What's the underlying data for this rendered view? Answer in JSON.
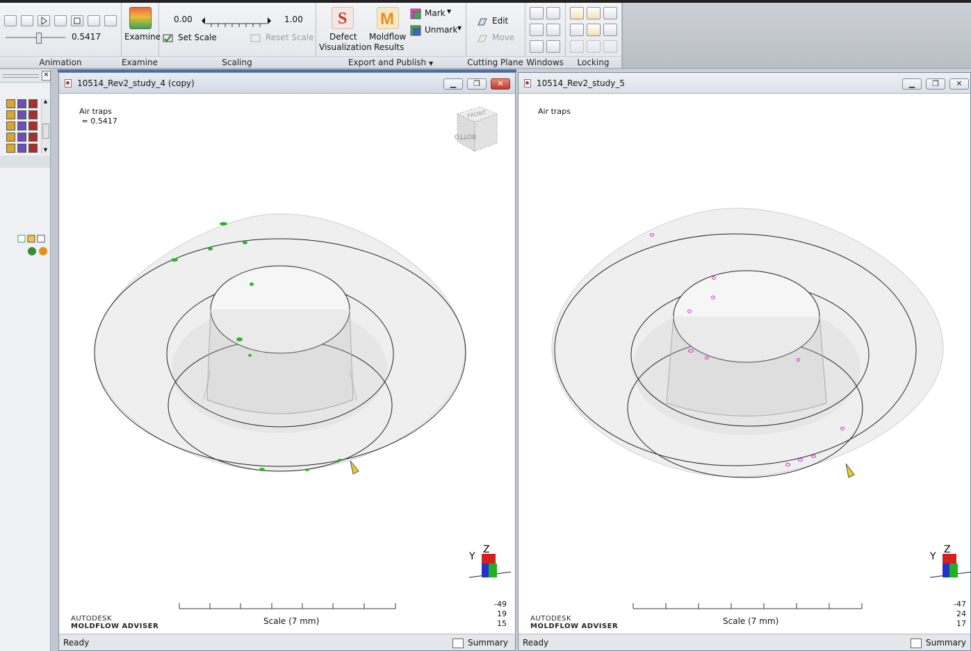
{
  "ribbon": {
    "animation": {
      "label": "Animation",
      "value": "0.5417",
      "progress": 0.5417
    },
    "examine": {
      "label": "Examine",
      "button": "Examine"
    },
    "scaling": {
      "label": "Scaling",
      "min": "0.00",
      "max": "1.00",
      "set_scale": "Set Scale",
      "reset_scale": "Reset Scale"
    },
    "export": {
      "label": "Export and Publish",
      "defect": [
        "Defect",
        "Visualization"
      ],
      "moldflow": [
        "Moldflow",
        "Results"
      ],
      "mark": "Mark",
      "unmark": "Unmark"
    },
    "cutting": {
      "label": "Cutting Plane",
      "edit": "Edit",
      "move": "Move"
    },
    "windows": {
      "label": "Windows"
    },
    "locking": {
      "label": "Locking"
    }
  },
  "windows": [
    {
      "title": "10514_Rev2_study_4 (copy)",
      "result_name": "Air traps",
      "result_value": " = 0.5417",
      "scale_label": "Scale (7 mm)",
      "coords": [
        "-49",
        "19",
        "15"
      ],
      "brand_line1": "AUTODESK",
      "brand_line2": "MOLDFLOW ADVISER",
      "status": "Ready",
      "summary": "Summary",
      "viewcube_top": "FRONT",
      "viewcube_bottom": "BOTTOM",
      "marker_color": "#22bb22"
    },
    {
      "title": "10514_Rev2_study_5",
      "result_name": "Air traps",
      "result_value": "",
      "scale_label": "Scale (7 mm)",
      "coords": [
        "-47",
        "24",
        "17"
      ],
      "brand_line1": "AUTODESK",
      "brand_line2": "MOLDFLOW ADVISER",
      "status": "Ready",
      "summary": "Summary",
      "marker_color": "#e020e0"
    }
  ],
  "axis": {
    "y": "Y",
    "z": "Z"
  }
}
